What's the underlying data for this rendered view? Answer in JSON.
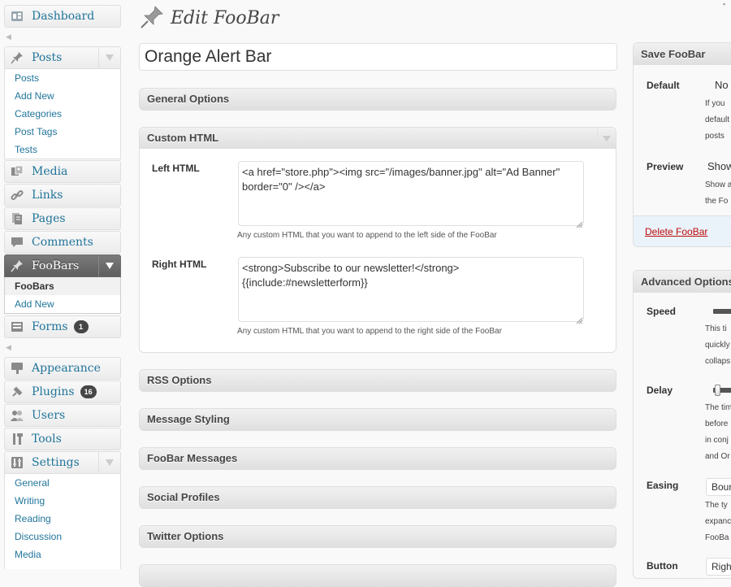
{
  "page": {
    "title": "Edit FooBar",
    "title_input_value": "Orange Alert Bar"
  },
  "sidebar": {
    "dashboard": {
      "label": "Dashboard",
      "icon": "dashboard-icon"
    },
    "posts": {
      "label": "Posts",
      "icon": "pushpin-icon",
      "submenu": [
        "Posts",
        "Add New",
        "Categories",
        "Post Tags",
        "Tests"
      ]
    },
    "media": {
      "label": "Media",
      "icon": "media-icon"
    },
    "links": {
      "label": "Links",
      "icon": "links-icon"
    },
    "pages": {
      "label": "Pages",
      "icon": "pages-icon"
    },
    "comments": {
      "label": "Comments",
      "icon": "comments-icon"
    },
    "foobars": {
      "label": "FooBars",
      "icon": "pushpin-icon",
      "submenu": [
        "FooBars",
        "Add New"
      ]
    },
    "forms": {
      "label": "Forms",
      "icon": "forms-icon",
      "badge": "1"
    },
    "appearance": {
      "label": "Appearance",
      "icon": "appearance-icon"
    },
    "plugins": {
      "label": "Plugins",
      "icon": "plugins-icon",
      "badge": "16"
    },
    "users": {
      "label": "Users",
      "icon": "users-icon"
    },
    "tools": {
      "label": "Tools",
      "icon": "tools-icon"
    },
    "settings": {
      "label": "Settings",
      "icon": "settings-icon",
      "submenu": [
        "General",
        "Writing",
        "Reading",
        "Discussion",
        "Media"
      ]
    }
  },
  "boxes": {
    "general_options": "General Options",
    "custom_html": {
      "title": "Custom HTML",
      "left_label": "Left HTML",
      "left_value": "<a href=\"store.php\"><img src=\"/images/banner.jpg\" alt=\"Ad Banner\" border=\"0\" /></a>",
      "left_desc": "Any custom HTML that you want to append to the left side of the FooBar",
      "right_label": "Right HTML",
      "right_value": "<strong>Subscribe to our newsletter!</strong>\n{{include:#newsletterform}}",
      "right_desc": "Any custom HTML that you want to append to the right side of the FooBar"
    },
    "rss_options": "RSS Options",
    "message_styling": "Message Styling",
    "foobar_messages": "FooBar Messages",
    "social_profiles": "Social Profiles",
    "twitter_options": "Twitter Options"
  },
  "save_box": {
    "title": "Save FooBar",
    "default_label": "Default",
    "default_value": "No",
    "default_desc": [
      "If you",
      "default",
      "posts"
    ],
    "preview_label": "Preview",
    "preview_value": "Show",
    "preview_desc": [
      "Show a",
      "the Fo"
    ],
    "delete_label": "Delete FooBar"
  },
  "advanced_box": {
    "title": "Advanced Options",
    "speed_label": "Speed",
    "speed_desc": [
      "This ti",
      "quickly",
      "collaps"
    ],
    "delay_label": "Delay",
    "delay_desc": [
      "The tim",
      "before",
      "in conj",
      "and Or"
    ],
    "easing_label": "Easing",
    "easing_value": "Boun",
    "easing_desc": [
      "The ty",
      "expanc",
      "FooBa"
    ],
    "button_label": "Button",
    "button_value": "Righ"
  },
  "colors": {
    "link": "#21759b",
    "current_menu": "#6d6d6d",
    "delete": "#bc0b0b"
  }
}
